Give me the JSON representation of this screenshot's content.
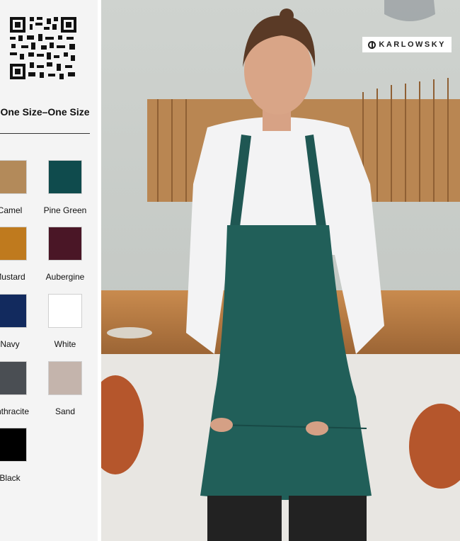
{
  "size_heading": "One Size–One Size",
  "colors": [
    {
      "name": "Camel",
      "hex": "#b38a5a"
    },
    {
      "name": "Pine Green",
      "hex": "#0f4b4d"
    },
    {
      "name": "Mustard",
      "hex": "#bf7a1e"
    },
    {
      "name": "Aubergine",
      "hex": "#4a1626"
    },
    {
      "name": "Navy",
      "hex": "#122a5e"
    },
    {
      "name": "White",
      "hex": "#ffffff"
    },
    {
      "name": "Anthracite",
      "hex": "#4a4e53"
    },
    {
      "name": "Sand",
      "hex": "#c4b4ac"
    },
    {
      "name": "Black",
      "hex": "#000000"
    }
  ],
  "brand": {
    "name": "KARLOWSKY"
  },
  "photo": {
    "subject": "model-wearing-pine-green-bib-apron"
  }
}
